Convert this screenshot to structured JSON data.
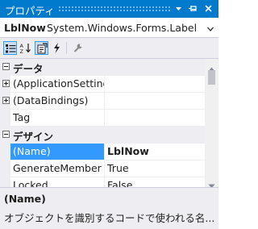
{
  "window": {
    "title": "プロパティ",
    "buttons": {
      "dropdown_icon": "dropdown-arrow-icon",
      "pin_icon": "pin-icon",
      "close_icon": "close-icon"
    }
  },
  "object_selector": {
    "name": "LblNow",
    "type": "System.Windows.Forms.Label"
  },
  "toolbar": {
    "buttons": [
      {
        "icon": "categorized-icon",
        "active": true
      },
      {
        "icon": "alphabetical-icon",
        "active": false
      },
      {
        "icon": "properties-icon",
        "active": true
      },
      {
        "icon": "events-icon",
        "active": false
      },
      {
        "icon": "property-pages-icon",
        "active": false
      }
    ]
  },
  "grid": {
    "categories": [
      {
        "label": "データ",
        "expanded": true,
        "properties": [
          {
            "name": "(ApplicationSettings)",
            "value": "",
            "expandable": true
          },
          {
            "name": "(DataBindings)",
            "value": "",
            "expandable": true
          },
          {
            "name": "Tag",
            "value": "",
            "expandable": false
          }
        ]
      },
      {
        "label": "デザイン",
        "expanded": true,
        "properties": [
          {
            "name": "(Name)",
            "value": "LblNow",
            "selected": true,
            "value_bold": true
          },
          {
            "name": "GenerateMember",
            "value": "True"
          },
          {
            "name": "Locked",
            "value": "False"
          }
        ]
      }
    ]
  },
  "description": {
    "title": "(Name)",
    "text": "オブジェクトを識別するコードで使われる名..."
  },
  "colors": {
    "titlebar": "#007acc",
    "selection": "#3399ff",
    "panel": "#eeeef2"
  }
}
